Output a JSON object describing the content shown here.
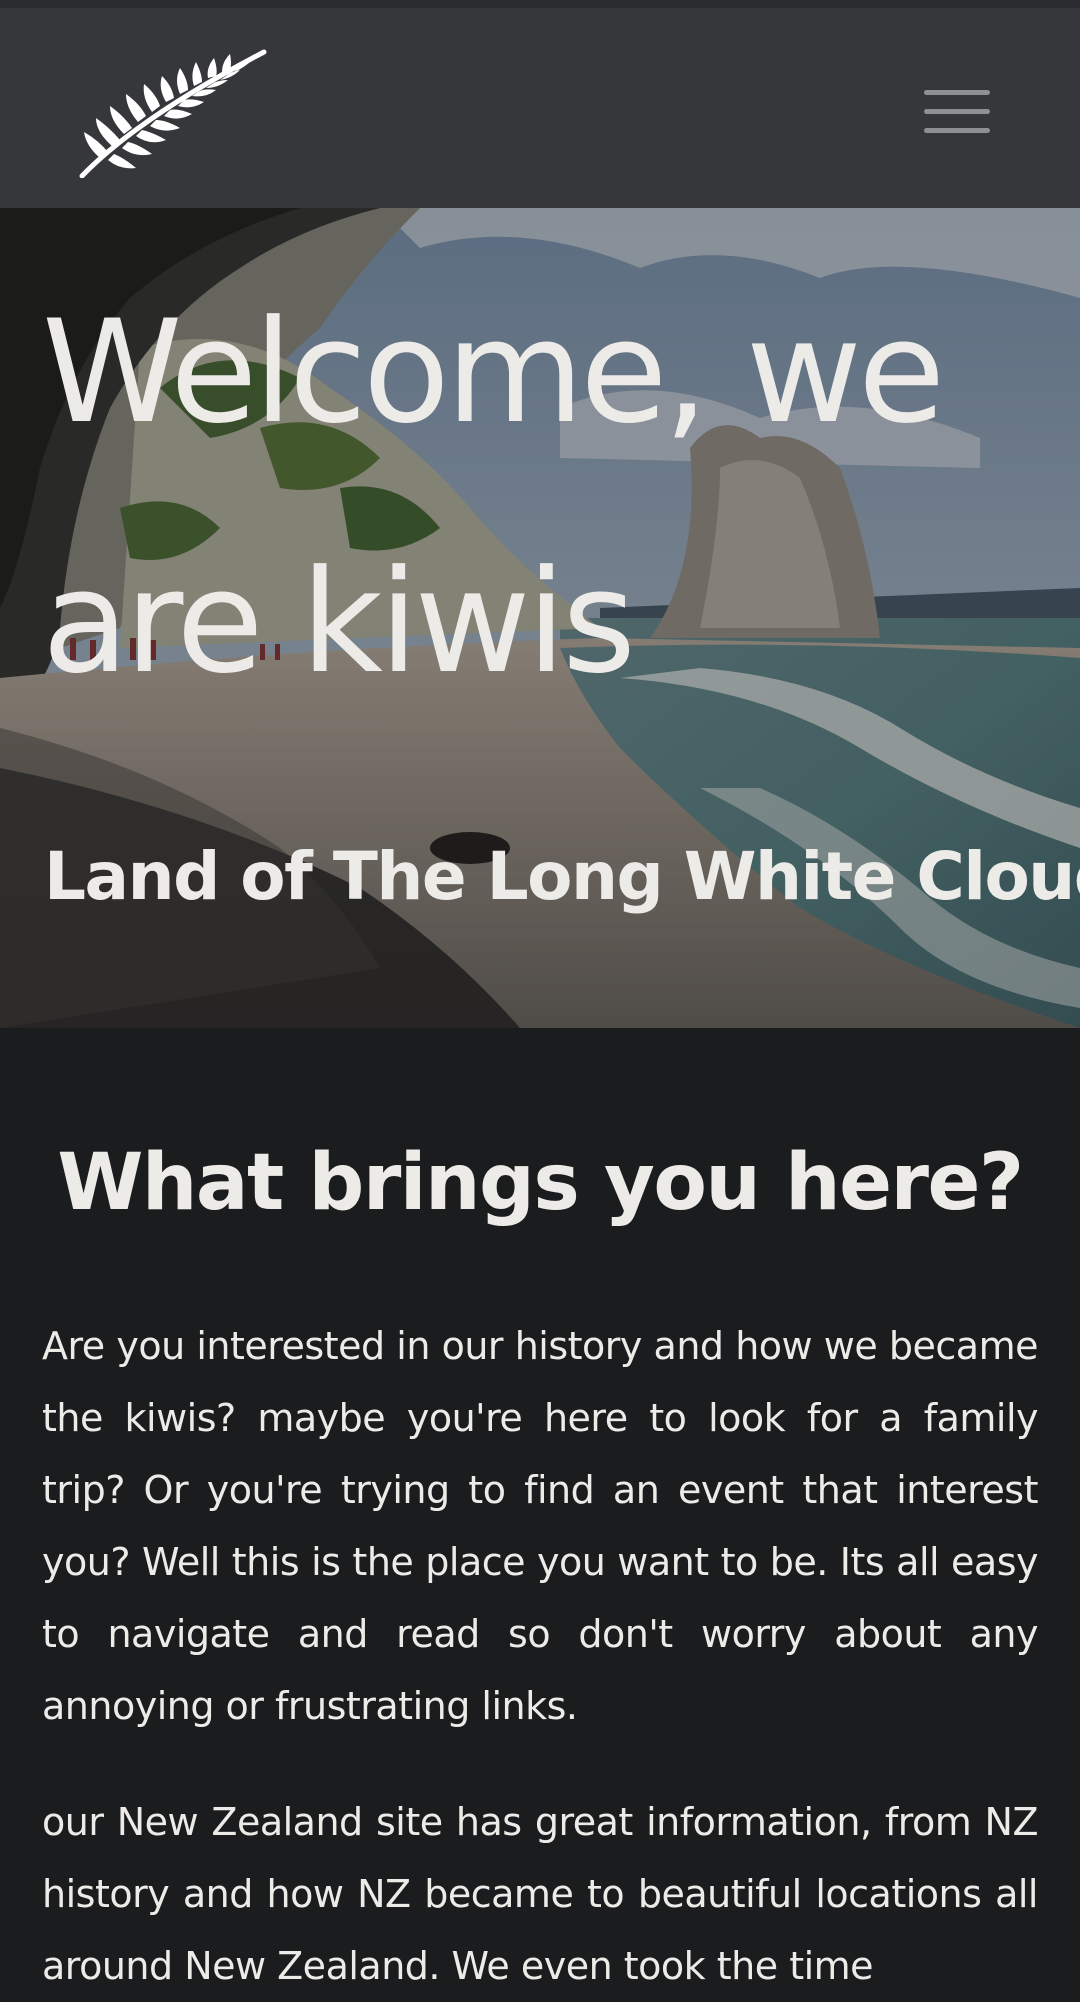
{
  "navbar": {
    "logo_icon": "silver-fern-icon",
    "menu_icon": "hamburger-menu-icon"
  },
  "hero": {
    "title": "Welcome, we are kiwis",
    "subtitle": "Land of The Long White Cloud"
  },
  "intro": {
    "heading": "What brings you here?",
    "paragraph_1": "Are you interested in our history and how we became the kiwis? maybe you're here to look for a family trip? Or you're trying to find an event that interest you? Well this is the place you want to be. Its all easy to navigate and read so don't worry about any annoying or frustrating links.",
    "paragraph_2": "our New Zealand site has great information, from NZ history and how NZ became to beautiful locations all around New Zealand. We even took the time"
  },
  "colors": {
    "navbar_bg": "#35373b",
    "page_bg": "#1b1c1e",
    "text": "#ecebe8"
  }
}
